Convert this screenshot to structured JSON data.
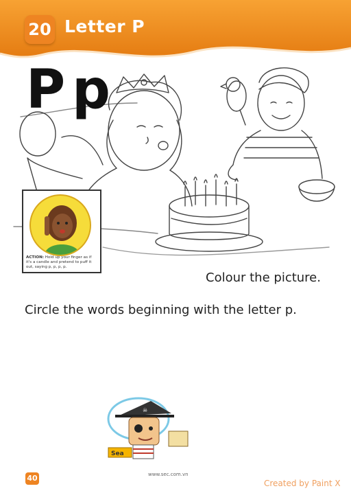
{
  "header": {
    "lesson_number": "20",
    "title": "Letter P",
    "background_color": "#f3921f",
    "accent_color": "#ee8422"
  },
  "heading_letters": {
    "upper": "P",
    "lower": "p"
  },
  "action_box": {
    "label": "ACTION:",
    "text": "Hold up your finger as if it's a candle and pretend to puff it out, saying p, p, p, p."
  },
  "instructions": {
    "colour": "Colour the picture.",
    "circle": "Circle the words beginning with the letter p."
  },
  "footer": {
    "page_number": "40",
    "website": "www.sec.com.vn",
    "credit": "Created by Paint X"
  },
  "mascot": {
    "sign_text": "Sea"
  },
  "icons": [
    "pirate-mascot-icon",
    "parrot-icon",
    "birthday-cake-icon",
    "finger-gesture-icon"
  ]
}
